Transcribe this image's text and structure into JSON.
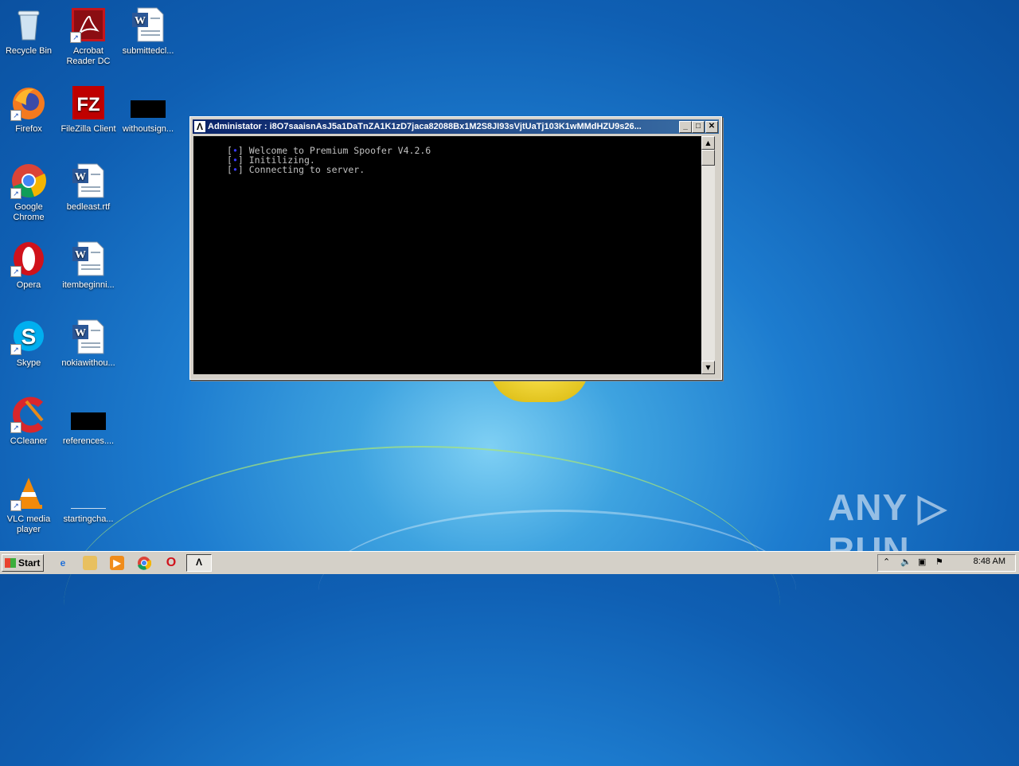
{
  "desktop": {
    "icons": [
      {
        "label": "Recycle Bin",
        "icon": "recycle-bin-icon"
      },
      {
        "label": "Acrobat Reader DC",
        "icon": "acrobat-icon"
      },
      {
        "label": "submittedcl...",
        "icon": "word-document-icon"
      },
      {
        "label": "Firefox",
        "icon": "firefox-icon"
      },
      {
        "label": "FileZilla Client",
        "icon": "filezilla-icon"
      },
      {
        "label": "withoutsign...",
        "icon": "redacted-file-icon"
      },
      {
        "label": "Google Chrome",
        "icon": "chrome-icon"
      },
      {
        "label": "bedleast.rtf",
        "icon": "word-document-icon"
      },
      {
        "label": "Opera",
        "icon": "opera-icon"
      },
      {
        "label": "itembeginni...",
        "icon": "word-document-icon"
      },
      {
        "label": "Skype",
        "icon": "skype-icon"
      },
      {
        "label": "nokiawithou...",
        "icon": "word-document-icon"
      },
      {
        "label": "CCleaner",
        "icon": "ccleaner-icon"
      },
      {
        "label": "references....",
        "icon": "redacted-file-icon"
      },
      {
        "label": "VLC media player",
        "icon": "vlc-icon"
      },
      {
        "label": "startingcha...",
        "icon": "blank-file-icon"
      }
    ]
  },
  "window": {
    "title": "Administator : i8O7saaisnAsJ5a1DaTnZA1K1zD7jaca82088Bx1M2S8JI93sVjtUaTj103K1wMMdHZU9s26...",
    "minimize": "_",
    "maximize": "□",
    "close": "✕",
    "console_lines": [
      {
        "bracket_open": "[",
        "marker": "•",
        "bracket_close": "]",
        "text": "Welcome to Premium Spoofer V4.2.6"
      },
      {
        "bracket_open": "[",
        "marker": "•",
        "bracket_close": "]",
        "text": "Initilizing."
      },
      {
        "bracket_open": "[",
        "marker": "•",
        "bracket_close": "]",
        "text": "Connecting to server."
      }
    ]
  },
  "taskbar": {
    "start_label": "Start",
    "clock": "8:48 AM",
    "tray_expand": "⌃",
    "apps": [
      "internet-explorer-icon",
      "file-explorer-icon",
      "media-player-icon",
      "chrome-icon",
      "opera-icon",
      "console-app-icon"
    ]
  },
  "watermark": "ANY ▷ RUN",
  "colors": {
    "titlebar_start": "#0a246a",
    "titlebar_end": "#3a6ea5",
    "console_bg": "#000000",
    "console_text": "#c0c0c0",
    "marker": "#3a3aff"
  }
}
